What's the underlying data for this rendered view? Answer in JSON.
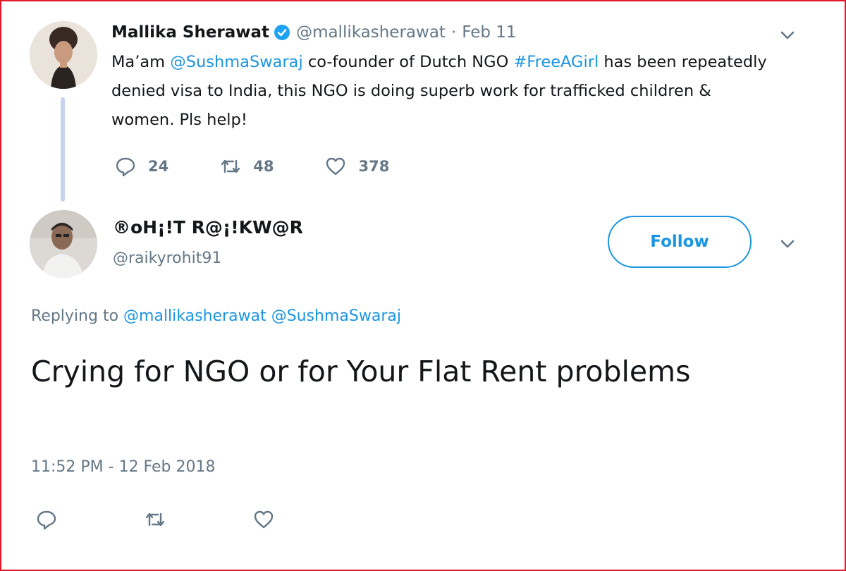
{
  "tweet1": {
    "name": "Mallika Sherawat",
    "handle": "@mallikasherawat",
    "separator": "·",
    "date": "Feb 11",
    "text_parts": {
      "p1": "Ma’am ",
      "mention": "@SushmaSwaraj",
      "p2": " co-founder of Dutch NGO ",
      "hashtag": "#FreeAGirl",
      "p3": " has been repeatedly denied visa to India, this NGO is doing superb work for trafficked children & women. Pls help!"
    },
    "replies": "24",
    "retweets": "48",
    "likes": "378"
  },
  "tweet2": {
    "name": "®oH¡!T R@¡!KW@R",
    "handle": "@raikyrohit91",
    "follow_label": "Follow",
    "replying_label": "Replying to",
    "replying_to": [
      "@mallikasherawat",
      "@SushmaSwaraj"
    ],
    "text": "Crying for NGO or for Your Flat Rent problems",
    "timestamp": "11:52 PM - 12 Feb 2018"
  },
  "colors": {
    "link": "#1b95e0",
    "secondary_text": "#657786",
    "frame_border": "#e0192b",
    "thread_line": "#c6d2f0"
  },
  "icons": {
    "verified": "verified-badge-icon",
    "reply": "reply-icon",
    "retweet": "retweet-icon",
    "like": "heart-icon",
    "menu": "chevron-down-icon"
  }
}
